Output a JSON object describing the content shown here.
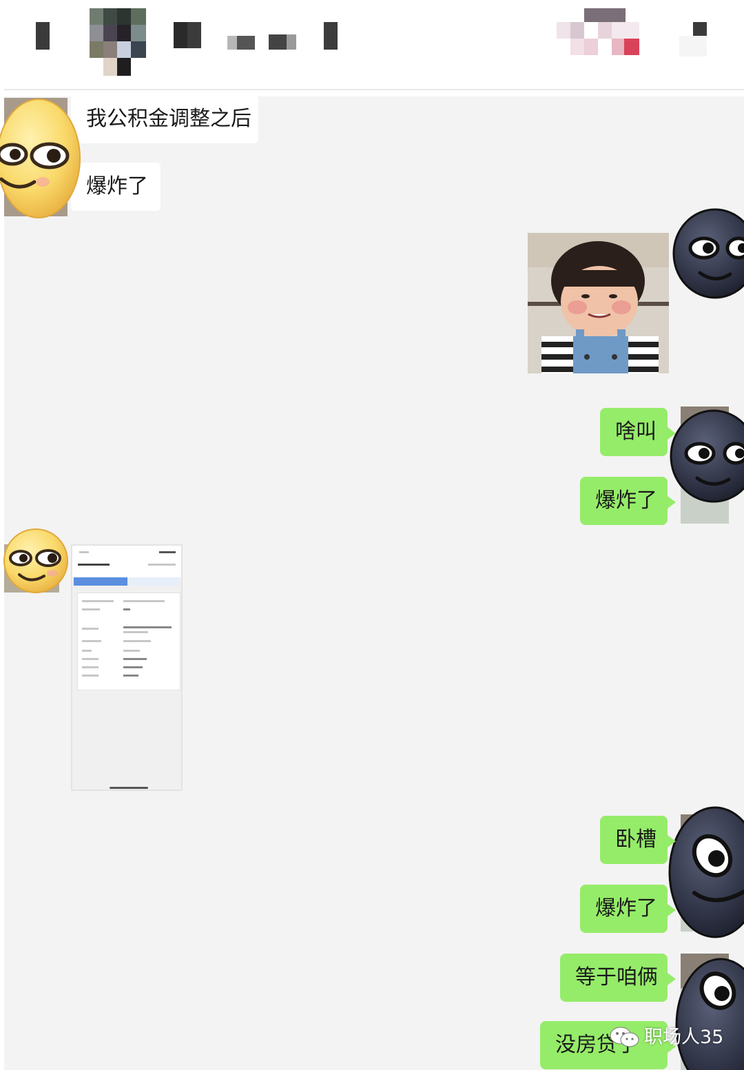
{
  "colors": {
    "chat_background": "#f3f3f3",
    "sent_bubble": "#95ec69",
    "received_bubble": "#ffffff"
  },
  "header": {
    "contact_name": "",
    "note": "title bar text is pixelated / mosaic-censored"
  },
  "messages": [
    {
      "side": "left",
      "type": "text",
      "text": "我公积金调整之后"
    },
    {
      "side": "left",
      "type": "text",
      "text": "爆炸了"
    },
    {
      "side": "right",
      "type": "image",
      "icon": "toddler-photo"
    },
    {
      "side": "right",
      "type": "text",
      "text": "啥叫"
    },
    {
      "side": "right",
      "type": "text",
      "text": "爆炸了"
    },
    {
      "side": "left",
      "type": "image",
      "icon": "housing-fund-screenshot"
    },
    {
      "side": "right",
      "type": "text",
      "text": "卧槽"
    },
    {
      "side": "right",
      "type": "text",
      "text": "爆炸了"
    },
    {
      "side": "right",
      "type": "text",
      "text": "等于咱俩"
    },
    {
      "side": "right",
      "type": "text",
      "text": "没房贷了"
    }
  ],
  "avatars": {
    "left": "smirk-emoji-yellow",
    "right": "smirk-emoji-dark"
  },
  "watermark": {
    "text": "职场人35",
    "icon": "wechat-icon"
  }
}
